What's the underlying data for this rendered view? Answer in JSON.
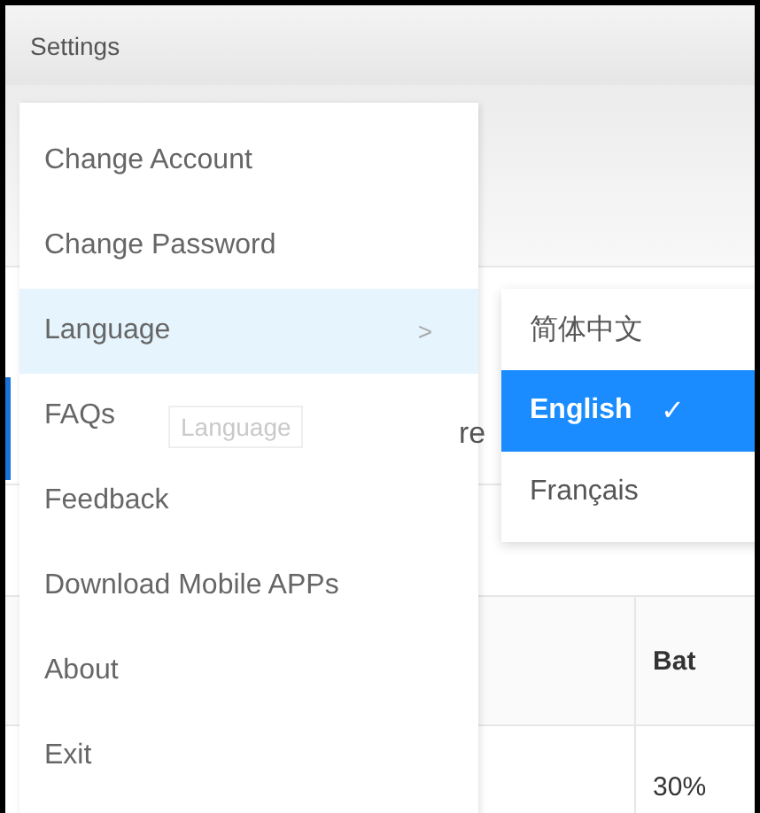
{
  "header": {
    "title": "Settings"
  },
  "background": {
    "tooltip": "Language",
    "partial_text": "re",
    "table": {
      "columns": [
        "Bat"
      ],
      "rows": [
        [
          "30%"
        ]
      ]
    }
  },
  "menu": {
    "items": [
      {
        "label": "Change Account",
        "selected": false
      },
      {
        "label": "Change Password",
        "selected": false
      },
      {
        "label": "Language",
        "selected": true,
        "arrow": ">"
      },
      {
        "label": "FAQs",
        "selected": false
      },
      {
        "label": "Feedback",
        "selected": false
      },
      {
        "label": "Download Mobile APPs",
        "selected": false
      },
      {
        "label": "About",
        "selected": false
      },
      {
        "label": "Exit",
        "selected": false
      }
    ]
  },
  "submenu": {
    "check_mark": "✓",
    "items": [
      {
        "label": "简体中文",
        "selected": false
      },
      {
        "label": "English",
        "selected": true
      },
      {
        "label": "Français",
        "selected": false
      }
    ]
  }
}
